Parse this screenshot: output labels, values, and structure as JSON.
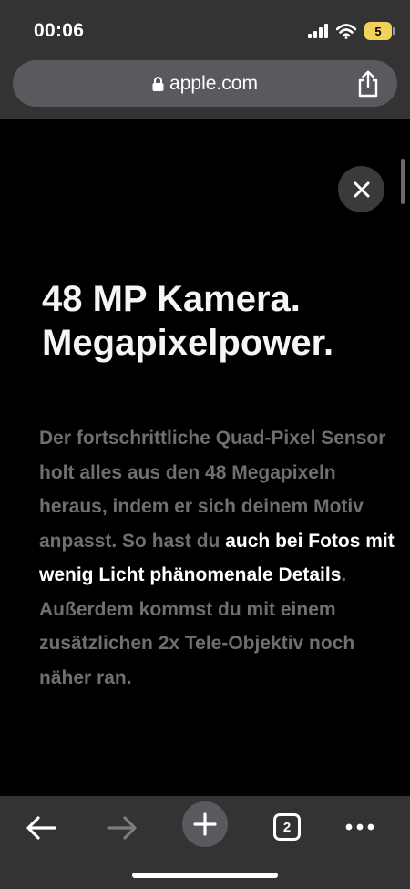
{
  "status_bar": {
    "time": "00:06",
    "battery_level": "5",
    "battery_color": "#f2d15a"
  },
  "browser": {
    "url": "apple.com",
    "tab_count": "2"
  },
  "content": {
    "headline_line1": "48 MP Kamera.",
    "headline_line2": "Megapixelpower.",
    "body_part1": "Der fortschrittliche Quad-Pixel Sensor holt alles aus den 48 Megapixeln heraus, indem er sich deinem Motiv anpasst. So hast du ",
    "body_highlight": "auch bei Fotos mit wenig Licht phänomenale Details",
    "body_part2": ". Außerdem kommst du mit einem zusätzlichen 2x Tele-Objektiv noch näher ran.",
    "muted_text_color": "#6e6e73",
    "highlight_text_color": "#ffffff"
  },
  "icons": {
    "close": "close-icon",
    "lock": "lock-icon",
    "share": "share-icon",
    "back": "back-arrow-icon",
    "forward": "forward-arrow-icon",
    "new_tab": "plus-icon",
    "tabs": "tabs-icon",
    "more": "more-dots-icon"
  }
}
